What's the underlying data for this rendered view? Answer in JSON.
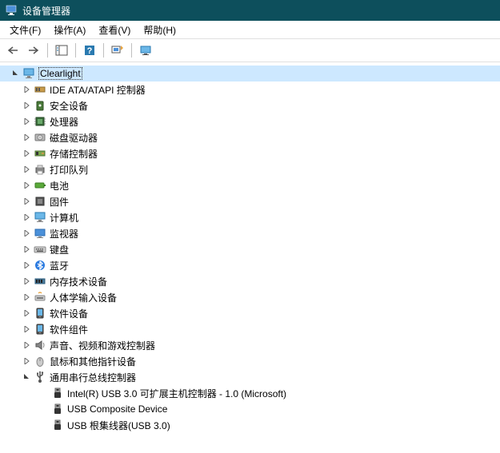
{
  "title": "设备管理器",
  "menus": {
    "file": "文件(F)",
    "action": "操作(A)",
    "view": "查看(V)",
    "help": "帮助(H)"
  },
  "tree": {
    "computer_name": "Clearlight",
    "items": [
      {
        "icon": "controller",
        "label": "IDE ATA/ATAPI 控制器"
      },
      {
        "icon": "security",
        "label": "安全设备"
      },
      {
        "icon": "cpu",
        "label": "处理器"
      },
      {
        "icon": "disk",
        "label": "磁盘驱动器"
      },
      {
        "icon": "storage",
        "label": "存储控制器"
      },
      {
        "icon": "printer",
        "label": "打印队列"
      },
      {
        "icon": "battery",
        "label": "电池"
      },
      {
        "icon": "firmware",
        "label": "固件"
      },
      {
        "icon": "computer",
        "label": "计算机"
      },
      {
        "icon": "monitor",
        "label": "监视器"
      },
      {
        "icon": "keyboard",
        "label": "键盘"
      },
      {
        "icon": "bluetooth",
        "label": "蓝牙"
      },
      {
        "icon": "memory",
        "label": "内存技术设备"
      },
      {
        "icon": "hid",
        "label": "人体学输入设备"
      },
      {
        "icon": "software",
        "label": "软件设备"
      },
      {
        "icon": "component",
        "label": "软件组件"
      },
      {
        "icon": "audio",
        "label": "声音、视频和游戏控制器"
      },
      {
        "icon": "mouse",
        "label": "鼠标和其他指针设备"
      },
      {
        "icon": "usb",
        "label": "通用串行总线控制器",
        "expanded": true,
        "children": [
          {
            "icon": "usb-plug",
            "label": "Intel(R) USB 3.0 可扩展主机控制器 - 1.0 (Microsoft)"
          },
          {
            "icon": "usb-plug",
            "label": "USB Composite Device"
          },
          {
            "icon": "usb-plug",
            "label": "USB 根集线器(USB 3.0)"
          }
        ]
      }
    ]
  }
}
